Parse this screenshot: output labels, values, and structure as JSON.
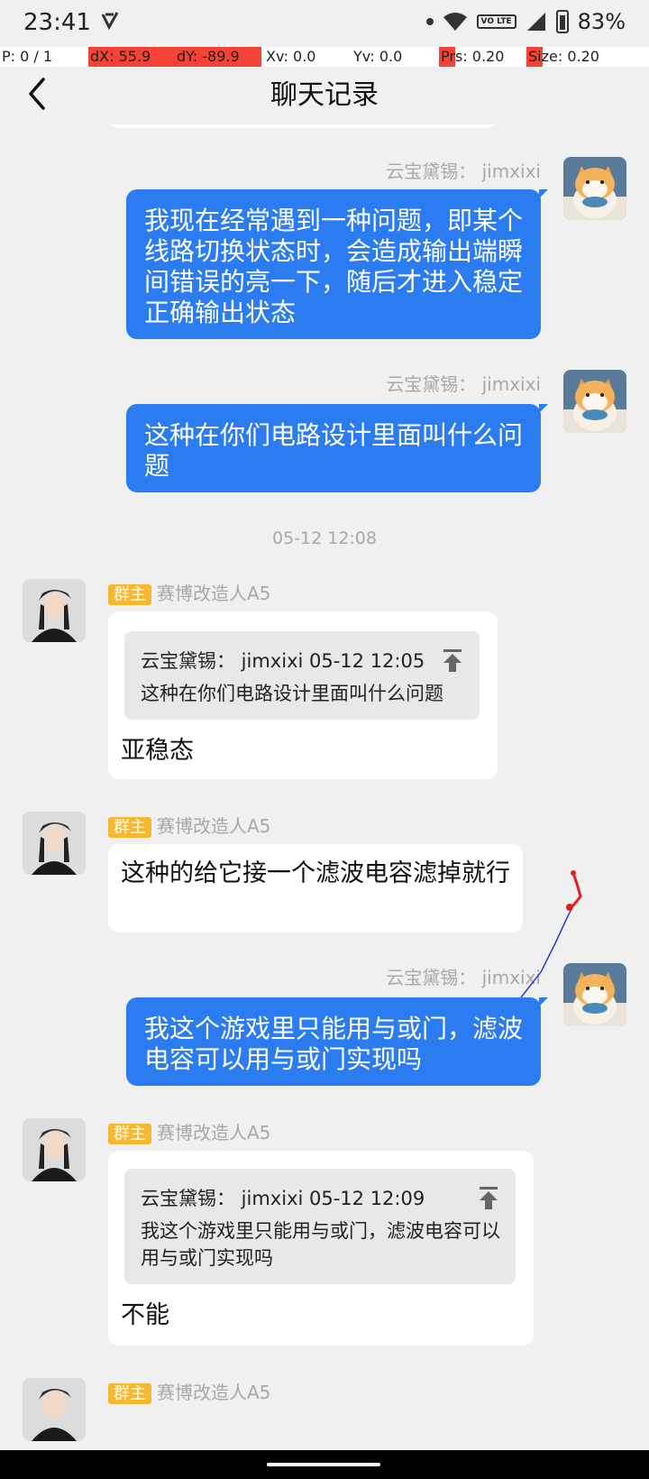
{
  "status_bar": {
    "time": "23:41",
    "network_badge": "VO LTE",
    "battery": "83%"
  },
  "debug": {
    "p": "P: 0 / 1",
    "dx": "dX: 55.9",
    "dy": "dY: -89.9",
    "xv": "Xv: 0.0",
    "yv": "Yv: 0.0",
    "prs": "Prs: 0.20",
    "size": "Size: 0.20"
  },
  "header": {
    "title": "聊天记录"
  },
  "messages": {
    "m1": {
      "sender": "云宝黛锡： jimxixi",
      "text": "我现在经常遇到一种问题，即某个线路切换状态时，会造成输出端瞬间错误的亮一下，随后才进入稳定正确输出状态"
    },
    "m2": {
      "sender": "云宝黛锡： jimxixi",
      "text": "这种在你们电路设计里面叫什么问题"
    },
    "timestamp": "05-12 12:08",
    "m3": {
      "badge": "群主",
      "sender": "赛博改造人A5",
      "quote_head": "云宝黛锡： jimxixi 05-12 12:05",
      "quote_body": "这种在你们电路设计里面叫什么问题",
      "text": "亚稳态"
    },
    "m4": {
      "badge": "群主",
      "sender": "赛博改造人A5",
      "text": "这种的给它接一个滤波电容滤掉就行"
    },
    "m5": {
      "sender": "云宝黛锡： jimxixi",
      "text": "我这个游戏里只能用与或门，滤波电容可以用与或门实现吗"
    },
    "m6": {
      "badge": "群主",
      "sender": "赛博改造人A5",
      "quote_head": "云宝黛锡： jimxixi 05-12 12:09",
      "quote_body": "我这个游戏里只能用与或门，滤波电容可以用与或门实现吗",
      "text": "不能"
    },
    "m7": {
      "badge": "群主",
      "sender": "赛博改造人A5"
    }
  },
  "colors": {
    "bubble_self": "#2b7cf0",
    "badge": "#f7b731",
    "background": "#f0f0f0"
  },
  "icons": [
    "back-chevron-icon",
    "wifi-icon",
    "signal-icon",
    "battery-icon",
    "pin-to-top-icon"
  ]
}
